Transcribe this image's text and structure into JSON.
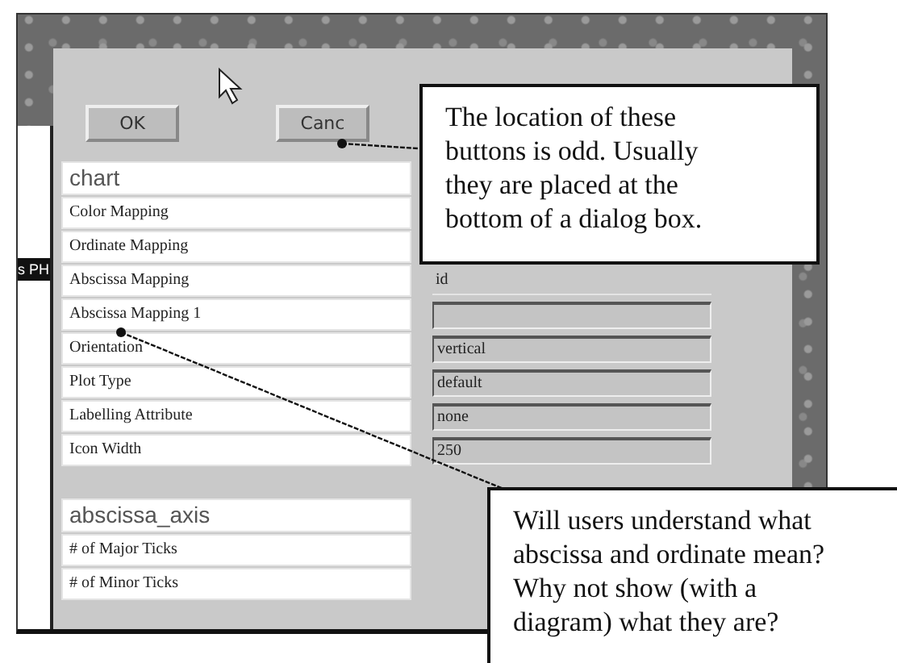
{
  "side_label": "s PH",
  "buttons": [
    {
      "label": "OK"
    },
    {
      "label": "Canc"
    }
  ],
  "sections": [
    {
      "title": "chart",
      "rows": [
        {
          "label": "Color Mapping"
        },
        {
          "label": "Ordinate Mapping"
        },
        {
          "label": "Abscissa Mapping",
          "field": {
            "kind": "plain",
            "value": "id"
          }
        },
        {
          "label": "Abscissa Mapping 1",
          "field": {
            "kind": "input"
          }
        },
        {
          "label": "Orientation",
          "field": {
            "kind": "input",
            "value": "vertical"
          }
        },
        {
          "label": "Plot Type",
          "field": {
            "kind": "input",
            "value": "default"
          }
        },
        {
          "label": "Labelling Attribute",
          "field": {
            "kind": "input",
            "value": "none"
          }
        },
        {
          "label": "Icon Width",
          "field": {
            "kind": "input",
            "value": "250"
          }
        }
      ]
    },
    {
      "title": "abscissa_axis",
      "rows": [
        {
          "label": "# of Major Ticks"
        },
        {
          "label": "# of Minor Ticks"
        }
      ]
    }
  ],
  "callouts": [
    {
      "text": "The location of these buttons is odd. Usually they are placed at the bottom of a dialog box."
    },
    {
      "text": "Will users understand what abscissa and ordinate mean? Why not show (with a diagram) what they are?"
    }
  ]
}
